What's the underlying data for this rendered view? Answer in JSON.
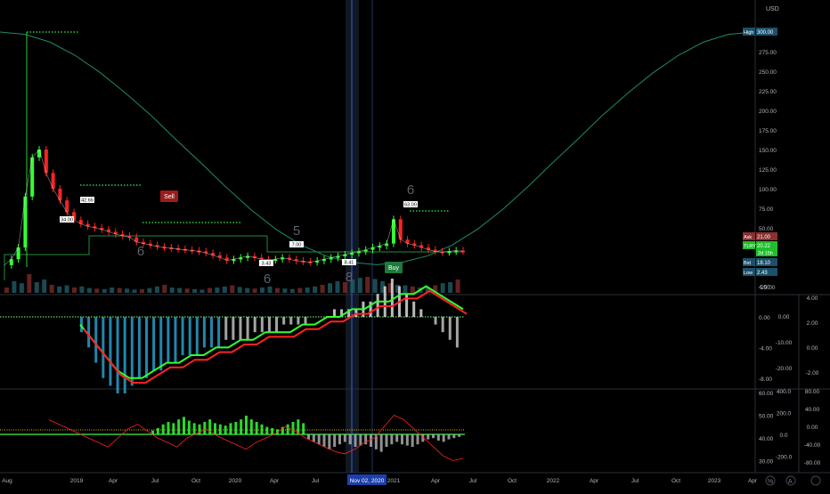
{
  "currency": "USD",
  "chart_data": {
    "type": "line",
    "x_ticks": [
      "Aug",
      "2019",
      "Apr",
      "Jul",
      "Oct",
      "2020",
      "Apr",
      "Jul",
      "Nov 02, 2020",
      "2021",
      "Apr",
      "Jul",
      "Oct",
      "2022",
      "Apr",
      "Jul",
      "Oct",
      "2023",
      "Apr"
    ],
    "main_pane": {
      "y_ticks": [
        300.0,
        275.0,
        250.0,
        225.0,
        200.0,
        175.0,
        150.0,
        125.0,
        100.0,
        75.0,
        50.0,
        25.0,
        -25.0
      ],
      "ylim": [
        -25,
        325
      ],
      "price_series": {
        "x": [
          0.0,
          0.5,
          1.0,
          1.5,
          2.0,
          2.5,
          3.0,
          3.5,
          4.0,
          4.5,
          5.0,
          5.5,
          6.0,
          6.5,
          7.0,
          7.5,
          8.0,
          8.5,
          9.0,
          9.5,
          10.0,
          10.5,
          11.0,
          11.5,
          12.0,
          12.5,
          13.0,
          13.5,
          14.0,
          14.5,
          15.0,
          15.5,
          16.0,
          16.5,
          17.0,
          17.5,
          18.0,
          18.5,
          19.0,
          19.5,
          20.0,
          20.5,
          21.0,
          21.5,
          22.0,
          22.5,
          23.0,
          23.5,
          24.0,
          24.5,
          25.0,
          25.5,
          26.0,
          26.5,
          27.0,
          27.5,
          28.0,
          28.5,
          29.0,
          29.5,
          30.0,
          30.5,
          31.0,
          31.5,
          32.0,
          32.5,
          33.0
        ],
        "y": [
          2.43,
          10,
          25,
          90,
          140,
          150,
          120,
          100,
          85,
          70,
          60,
          55,
          52,
          50,
          48,
          45,
          42,
          40,
          38,
          32,
          30,
          28,
          26,
          25,
          24,
          23,
          22,
          21,
          20,
          18,
          15,
          12,
          8.41,
          10,
          12,
          14,
          12,
          10,
          9,
          10,
          12,
          10,
          8,
          7,
          6.41,
          8,
          10,
          12,
          14,
          16,
          18,
          20,
          22,
          25,
          27,
          30,
          61,
          35,
          30,
          28,
          25,
          22,
          20,
          19,
          20,
          21,
          20.22
        ]
      },
      "cycle_wave": {
        "name": "",
        "x": [
          0,
          2,
          4,
          6,
          8,
          10,
          12,
          14,
          16,
          18,
          20,
          22,
          24,
          26,
          28,
          30,
          32,
          34,
          36,
          38,
          40,
          42,
          44,
          46,
          48,
          50,
          52,
          54,
          56,
          58,
          60
        ],
        "y": [
          300,
          297,
          287,
          270,
          248,
          222,
          194,
          163,
          133,
          102,
          73,
          48,
          28,
          14,
          6,
          3,
          6,
          14,
          28,
          48,
          73,
          102,
          133,
          163,
          194,
          222,
          248,
          270,
          287,
          297,
          300
        ]
      },
      "annotations": [
        "Sell",
        "Buy",
        "6",
        "6",
        "5",
        "8",
        "6"
      ],
      "price_labels": [
        "34.00",
        "42.66",
        "63.00",
        "7.00",
        "3.43",
        "8.41"
      ],
      "right_tags": [
        {
          "label": "High",
          "value": "300.00",
          "color": "#1d5069"
        },
        {
          "label": "Ask",
          "value": "21.00",
          "color": "#8c2f2f"
        },
        {
          "label": "TLRY",
          "value": "20.22",
          "sub": "2d 15h",
          "color": "#1fbf2c"
        },
        {
          "label": "Bid",
          "value": "18.10",
          "color": "#1d5069"
        },
        {
          "label": "Low",
          "value": "2.43",
          "color": "#1d5069"
        }
      ],
      "volume": [
        10,
        22,
        18,
        35,
        20,
        25,
        15,
        12,
        14,
        10,
        12,
        9,
        8,
        7,
        10,
        9,
        8,
        6,
        7,
        9,
        12,
        15,
        10,
        9,
        8,
        7,
        6,
        9,
        10,
        12,
        14,
        11,
        9,
        8,
        10,
        12,
        9,
        8,
        7,
        9,
        10,
        12,
        15,
        18,
        22,
        20,
        25,
        28,
        30,
        26,
        22,
        18,
        15,
        14,
        12,
        10,
        11,
        14,
        18,
        20,
        25
      ]
    },
    "oscillator_pane": {
      "y_ticks_left": [
        4.0,
        0.0,
        -4.0,
        -8.0
      ],
      "y_ticks_right_inner": [
        0.0,
        -10.0,
        -20.0
      ],
      "y_ticks_right_outer": [
        4.0,
        2.0,
        0.0,
        -2.0
      ],
      "histogram": [
        -2,
        -4,
        -6,
        -8,
        -9,
        -10,
        -10,
        -9,
        -8,
        -8,
        -7,
        -7,
        -6,
        -6,
        -5,
        -5,
        -5,
        -4,
        -4,
        -4,
        -3,
        -3,
        -3,
        -3,
        -2,
        -2,
        -2,
        -2,
        -1,
        -1,
        -1,
        -1,
        0,
        0,
        0,
        1,
        1,
        1,
        1,
        2,
        2,
        3,
        4,
        5,
        4,
        3,
        2,
        1,
        0,
        -1,
        -2,
        -3,
        -4
      ],
      "fast_line": [
        -1,
        -3,
        -5,
        -7,
        -8,
        -8,
        -7,
        -6,
        -6,
        -5,
        -5,
        -4,
        -4,
        -3,
        -3,
        -2,
        -2,
        -2,
        -1,
        -1,
        0,
        0,
        1,
        1,
        2,
        2,
        3,
        3,
        4,
        3,
        2,
        1
      ]
    },
    "rsi_pane": {
      "y_ticks_left": [
        60.0,
        50.0,
        40.0,
        30.0
      ],
      "y_ticks_right_inner": [
        400.0,
        200.0,
        0.0,
        -200.0
      ],
      "y_ticks_right_outer": [
        80.0,
        40.0,
        0.0,
        -40.0,
        -80.0
      ],
      "histogram": [
        3,
        5,
        8,
        10,
        9,
        12,
        14,
        11,
        9,
        8,
        10,
        12,
        9,
        8,
        7,
        9,
        10,
        12,
        15,
        12,
        10,
        8,
        6,
        5,
        4,
        6,
        8,
        10,
        12,
        9,
        -4,
        -6,
        -8,
        -10,
        -12,
        -10,
        -8,
        -6,
        -8,
        -10,
        -9,
        -8,
        -10,
        -12,
        -14,
        -10,
        -8,
        -6,
        -8,
        -9,
        -10,
        -8,
        -6,
        -4,
        -3,
        -5,
        -6,
        -4,
        -3,
        -2
      ],
      "line": [
        48,
        46,
        44,
        42,
        40,
        38,
        36,
        40,
        44,
        46,
        43,
        40,
        38,
        36,
        40,
        42,
        44,
        41,
        39,
        37,
        35,
        38,
        40,
        42,
        45,
        43,
        40,
        38,
        36,
        34,
        33,
        35,
        38,
        40,
        45,
        50,
        48,
        44,
        40,
        36,
        32,
        30,
        31
      ]
    }
  }
}
